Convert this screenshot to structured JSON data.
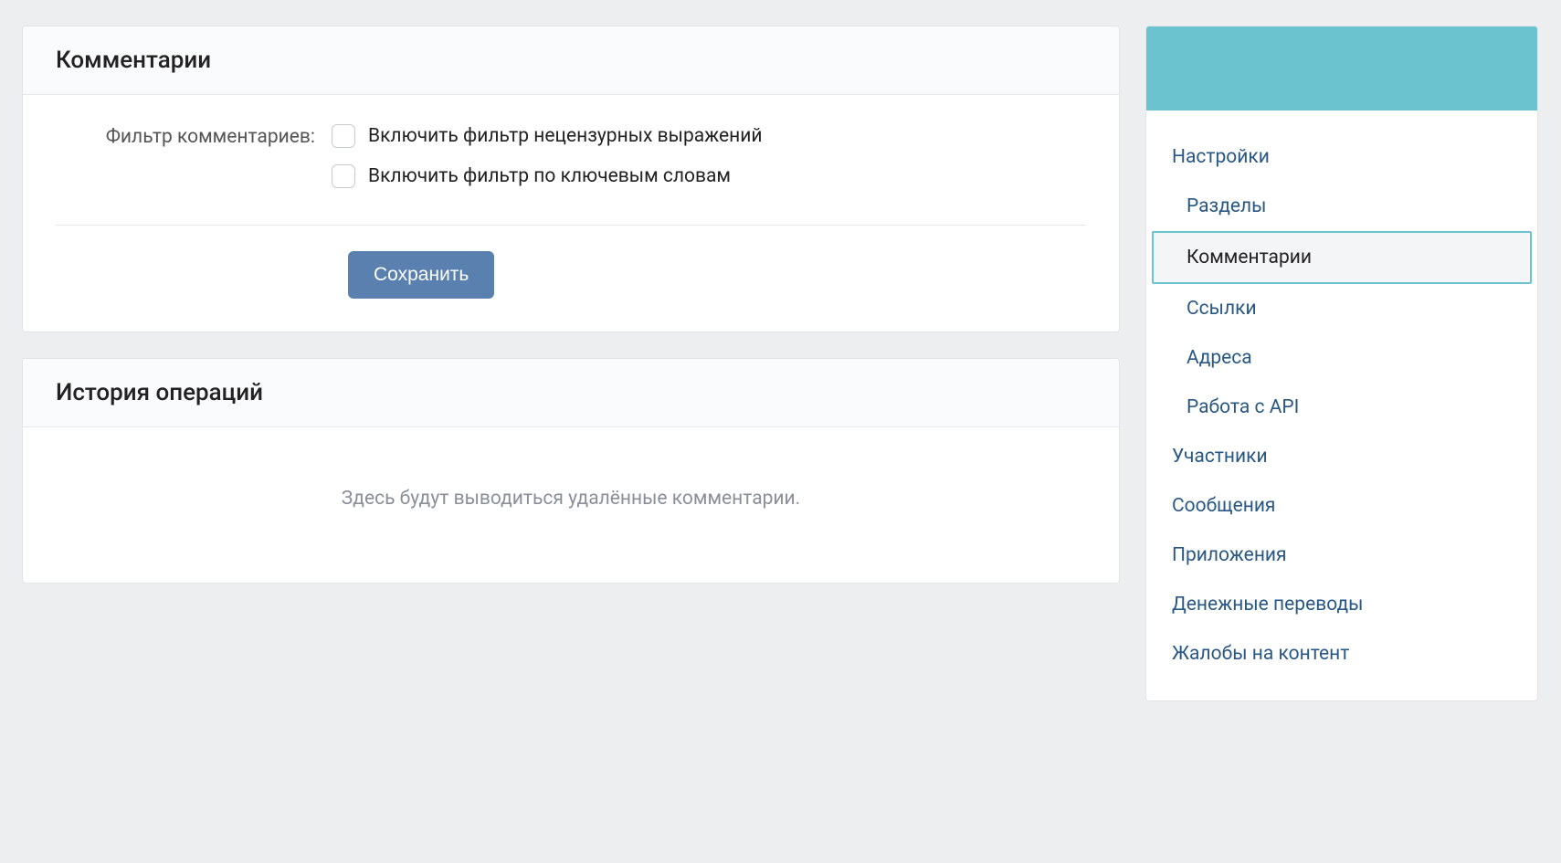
{
  "main": {
    "comments_card": {
      "title": "Комментарии",
      "filter_label": "Фильтр комментариев:",
      "checkbox_profanity": "Включить фильтр нецензурных выражений",
      "checkbox_keywords": "Включить фильтр по ключевым словам",
      "save_button": "Сохранить"
    },
    "history_card": {
      "title": "История операций",
      "empty_text": "Здесь будут выводиться удалённые комментарии."
    }
  },
  "sidebar": {
    "items": [
      {
        "label": "Настройки",
        "sub": false,
        "active": false
      },
      {
        "label": "Разделы",
        "sub": true,
        "active": false
      },
      {
        "label": "Комментарии",
        "sub": true,
        "active": true
      },
      {
        "label": "Ссылки",
        "sub": true,
        "active": false
      },
      {
        "label": "Адреса",
        "sub": true,
        "active": false
      },
      {
        "label": "Работа с API",
        "sub": true,
        "active": false
      },
      {
        "label": "Участники",
        "sub": false,
        "active": false
      },
      {
        "label": "Сообщения",
        "sub": false,
        "active": false
      },
      {
        "label": "Приложения",
        "sub": false,
        "active": false
      },
      {
        "label": "Денежные переводы",
        "sub": false,
        "active": false
      },
      {
        "label": "Жалобы на контент",
        "sub": false,
        "active": false
      }
    ]
  }
}
